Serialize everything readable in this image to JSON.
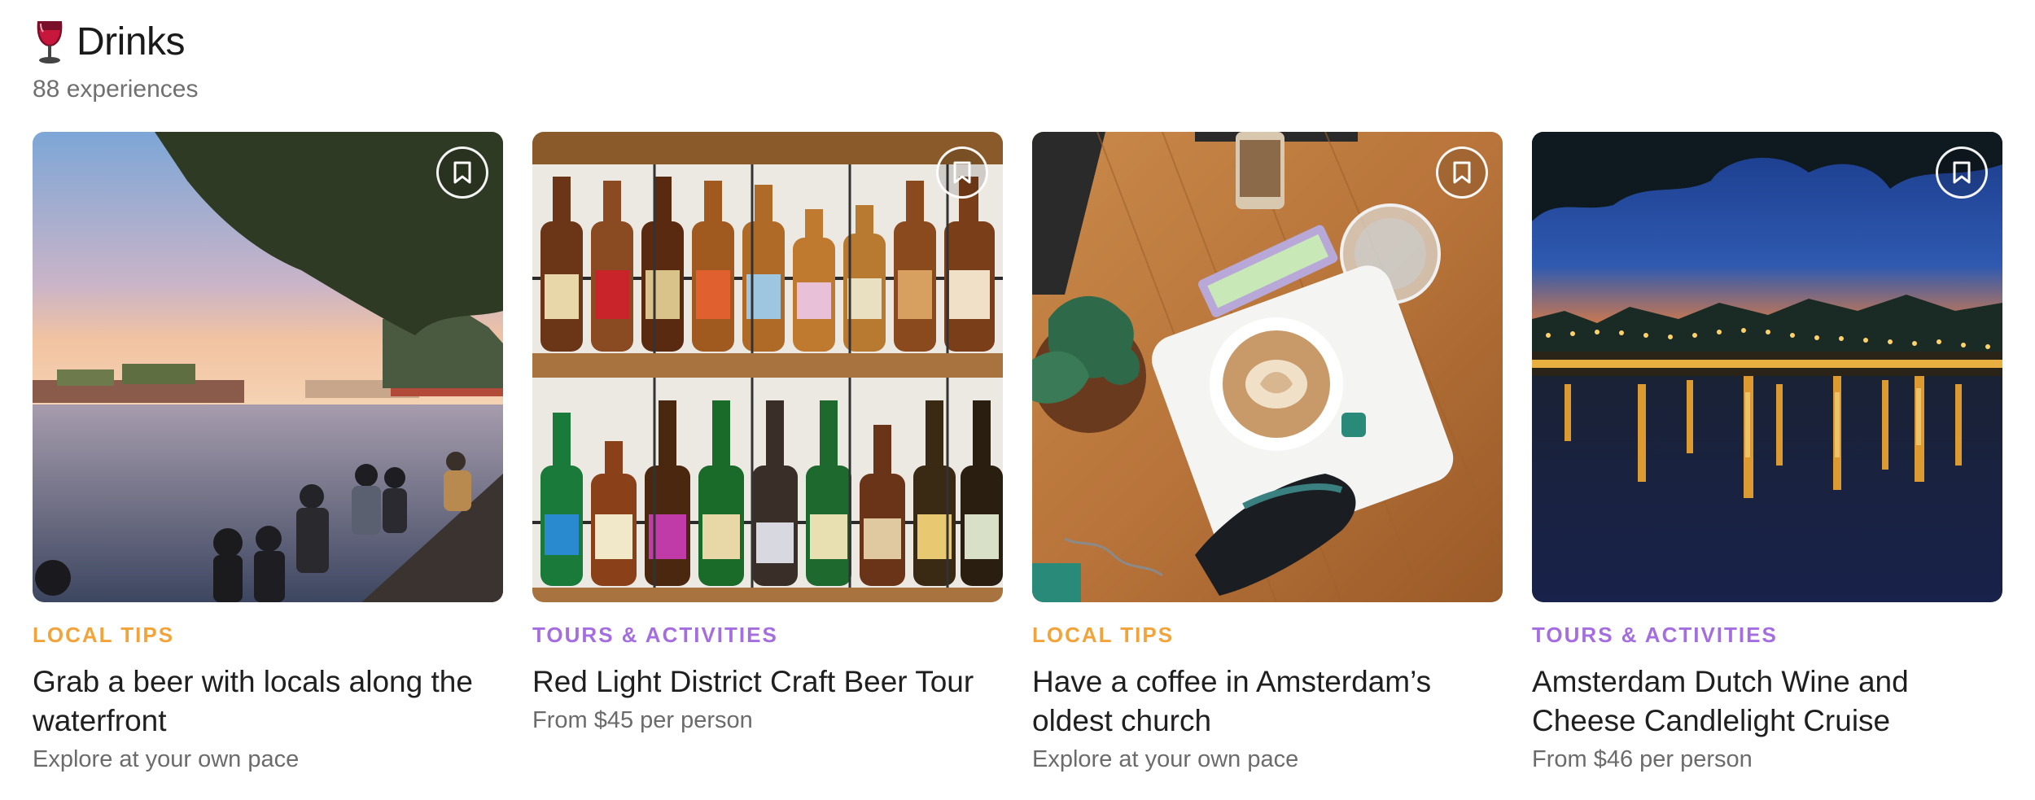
{
  "section": {
    "icon": "wine-glass-icon",
    "title": "Drinks",
    "count_text": "88 experiences"
  },
  "colors": {
    "local_tips": "#f2a33a",
    "tours_activities": "#a46ee0",
    "title_text": "#1f1f1f",
    "muted_text": "#6b6b6b"
  },
  "cards": [
    {
      "image": "waterfront-sunset-photo",
      "save_icon": "bookmark-icon",
      "category": "LOCAL TIPS",
      "category_type": "local",
      "title": "Grab a beer with locals along the waterfront",
      "subtitle": "Explore at your own pace"
    },
    {
      "image": "beer-bottles-shelf-photo",
      "save_icon": "bookmark-icon",
      "category": "TOURS & ACTIVITIES",
      "category_type": "tours",
      "title": "Red Light District Craft Beer Tour",
      "subtitle": "From $45 per person"
    },
    {
      "image": "coffee-table-photo",
      "save_icon": "bookmark-icon",
      "category": "LOCAL TIPS",
      "category_type": "local",
      "title": "Have a coffee in Amsterdam’s oldest church",
      "subtitle": "Explore at your own pace"
    },
    {
      "image": "canal-night-lights-photo",
      "save_icon": "bookmark-icon",
      "category": "TOURS & ACTIVITIES",
      "category_type": "tours",
      "title": "Amsterdam Dutch Wine and Cheese Candlelight Cruise",
      "subtitle": "From $46 per person"
    }
  ]
}
